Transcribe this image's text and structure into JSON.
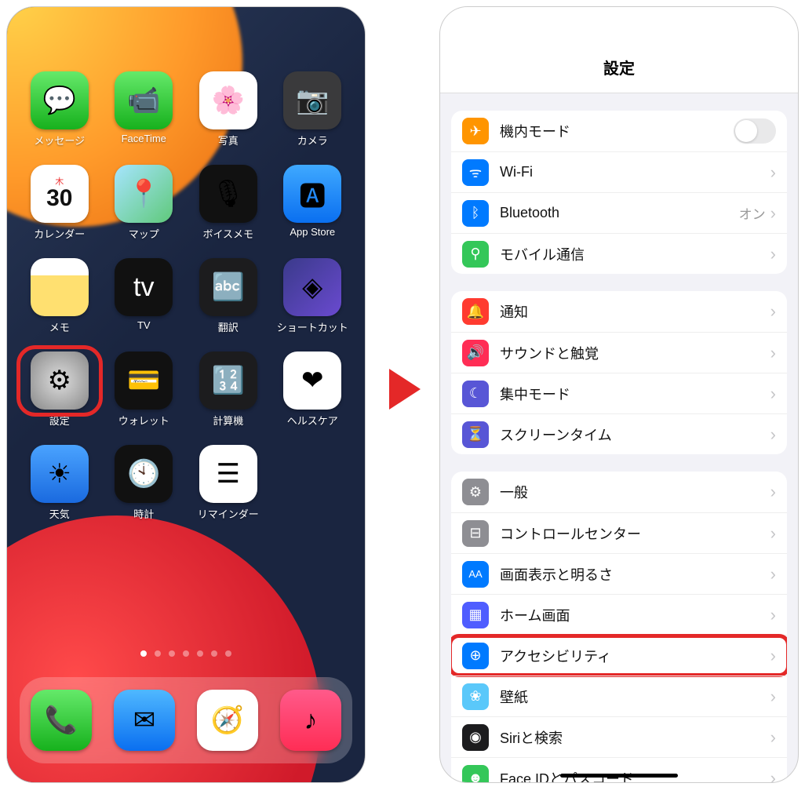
{
  "home": {
    "apps": [
      {
        "label": "メッセージ",
        "name": "messages-app",
        "bg": "linear-gradient(#65e96a,#17b11d)",
        "glyph": "💬"
      },
      {
        "label": "FaceTime",
        "name": "facetime-app",
        "bg": "linear-gradient(#65e96a,#17b11d)",
        "glyph": "📹"
      },
      {
        "label": "写真",
        "name": "photos-app",
        "bg": "#fff",
        "glyph": "🌸"
      },
      {
        "label": "カメラ",
        "name": "camera-app",
        "bg": "#3a3a3c",
        "glyph": "📷"
      },
      {
        "label": "カレンダー",
        "name": "calendar-app",
        "bg": "#fff",
        "glyph": "",
        "day": "木",
        "date": "30"
      },
      {
        "label": "マップ",
        "name": "maps-app",
        "bg": "linear-gradient(135deg,#a6e5ff,#5fc97a)",
        "glyph": "📍"
      },
      {
        "label": "ボイスメモ",
        "name": "voicememo-app",
        "bg": "#111",
        "glyph": "🎙"
      },
      {
        "label": "App Store",
        "name": "appstore-app",
        "bg": "linear-gradient(#3fa9ff,#0a6ff0)",
        "glyph": "🅰"
      },
      {
        "label": "メモ",
        "name": "notes-app",
        "bg": "linear-gradient(#fff 30%,#ffe070 30%)",
        "glyph": ""
      },
      {
        "label": "TV",
        "name": "tv-app",
        "bg": "#111",
        "glyph": "tv",
        "txtcolor": "#fff"
      },
      {
        "label": "翻訳",
        "name": "translate-app",
        "bg": "#1c1c1e",
        "glyph": "🔤"
      },
      {
        "label": "ショートカット",
        "name": "shortcuts-app",
        "bg": "linear-gradient(135deg,#3a3a8a,#6a4ad0)",
        "glyph": "◈"
      },
      {
        "label": "設定",
        "name": "settings-app",
        "bg": "radial-gradient(#ddd,#888)",
        "glyph": "⚙",
        "highlight": true
      },
      {
        "label": "ウォレット",
        "name": "wallet-app",
        "bg": "#111",
        "glyph": "💳"
      },
      {
        "label": "計算機",
        "name": "calculator-app",
        "bg": "#1c1c1e",
        "glyph": "🔢"
      },
      {
        "label": "ヘルスケア",
        "name": "health-app",
        "bg": "#fff",
        "glyph": "❤"
      },
      {
        "label": "天気",
        "name": "weather-app",
        "bg": "linear-gradient(#4aa3ff,#1a6adf)",
        "glyph": "☀"
      },
      {
        "label": "時計",
        "name": "clock-app",
        "bg": "#111",
        "glyph": "🕙"
      },
      {
        "label": "リマインダー",
        "name": "reminders-app",
        "bg": "#fff",
        "glyph": "☰"
      }
    ],
    "dock": [
      {
        "name": "phone-app",
        "bg": "linear-gradient(#65e96a,#17b11d)",
        "glyph": "📞"
      },
      {
        "name": "mail-app",
        "bg": "linear-gradient(#4fb8ff,#0a6ff0)",
        "glyph": "✉"
      },
      {
        "name": "safari-app",
        "bg": "#fff",
        "glyph": "🧭"
      },
      {
        "name": "music-app",
        "bg": "linear-gradient(#ff5a8a,#ff2d55)",
        "glyph": "♪"
      }
    ]
  },
  "settings": {
    "title": "設定",
    "groups": [
      [
        {
          "name": "airplane-mode-row",
          "icon": "✈",
          "bg": "#ff9500",
          "label": "機内モード",
          "toggle": true
        },
        {
          "name": "wifi-row",
          "icon": "ᯤ",
          "bg": "#007aff",
          "label": "Wi-Fi",
          "chevron": true
        },
        {
          "name": "bluetooth-row",
          "icon": "ᛒ",
          "bg": "#007aff",
          "label": "Bluetooth",
          "detail": "オン",
          "chevron": true
        },
        {
          "name": "cellular-row",
          "icon": "⚲",
          "bg": "#34c759",
          "label": "モバイル通信",
          "chevron": true
        }
      ],
      [
        {
          "name": "notifications-row",
          "icon": "🔔",
          "bg": "#ff3b30",
          "label": "通知",
          "chevron": true
        },
        {
          "name": "sounds-row",
          "icon": "🔊",
          "bg": "#ff2d55",
          "label": "サウンドと触覚",
          "chevron": true
        },
        {
          "name": "focus-row",
          "icon": "☾",
          "bg": "#5856d6",
          "label": "集中モード",
          "chevron": true
        },
        {
          "name": "screentime-row",
          "icon": "⏳",
          "bg": "#5856d6",
          "label": "スクリーンタイム",
          "chevron": true
        }
      ],
      [
        {
          "name": "general-row",
          "icon": "⚙",
          "bg": "#8e8e93",
          "label": "一般",
          "chevron": true
        },
        {
          "name": "control-center-row",
          "icon": "⊟",
          "bg": "#8e8e93",
          "label": "コントロールセンター",
          "chevron": true
        },
        {
          "name": "display-row",
          "icon": "AA",
          "bg": "#007aff",
          "label": "画面表示と明るさ",
          "chevron": true,
          "small": true
        },
        {
          "name": "homescreen-row",
          "icon": "▦",
          "bg": "#4f5dff",
          "label": "ホーム画面",
          "chevron": true
        },
        {
          "name": "accessibility-row",
          "icon": "⊕",
          "bg": "#007aff",
          "label": "アクセシビリティ",
          "chevron": true,
          "highlight": true
        },
        {
          "name": "wallpaper-row",
          "icon": "❀",
          "bg": "#5ac8fa",
          "label": "壁紙",
          "chevron": true
        },
        {
          "name": "siri-row",
          "icon": "◉",
          "bg": "#1c1c1e",
          "label": "Siriと検索",
          "chevron": true
        },
        {
          "name": "faceid-row",
          "icon": "☻",
          "bg": "#34c759",
          "label": "Face IDとパスコード",
          "chevron": true
        }
      ]
    ]
  }
}
